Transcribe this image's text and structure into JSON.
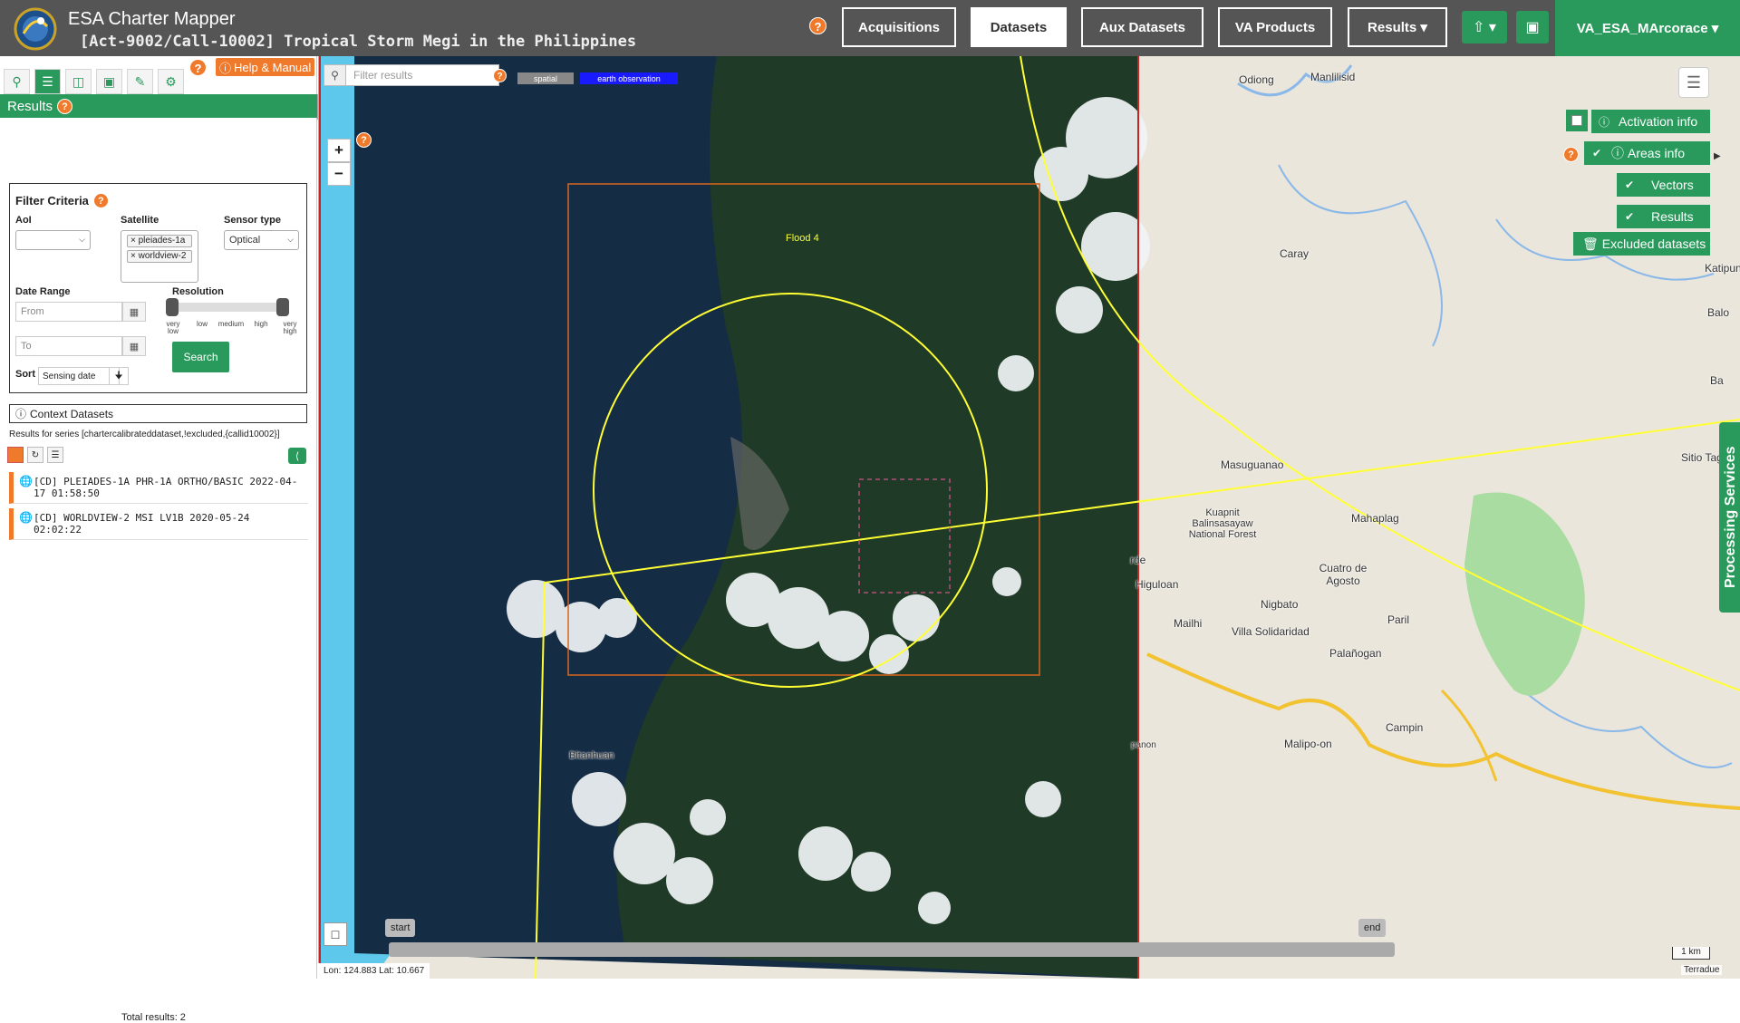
{
  "header": {
    "app_title": "ESA Charter Mapper",
    "activation_title": "[Act-9002/Call-10002] Tropical Storm Megi in the Philippines",
    "help": "?",
    "nav": [
      "Acquisitions",
      "Datasets",
      "Aux Datasets",
      "VA Products",
      "Results ▾"
    ],
    "active_nav": "Datasets",
    "upload_icon": "⇧ ▾",
    "briefcase_icon": "▣",
    "user": "VA_ESA_MArcorace ▾"
  },
  "left_panel": {
    "help_manual": "Help & Manual",
    "results_title": "Results",
    "filter": {
      "title": "Filter Criteria",
      "aoi_label": "AoI",
      "satellite_label": "Satellite",
      "satellite_tags": [
        "× pleiades-1a",
        "× worldview-2"
      ],
      "sensor_label": "Sensor type",
      "sensor_value": "Optical",
      "date_label": "Date Range",
      "from_placeholder": "From",
      "to_placeholder": "To",
      "resolution_label": "Resolution",
      "resolution_ticks": [
        "very low",
        "low",
        "medium",
        "high",
        "very high"
      ],
      "search_label": "Search",
      "sort_label": "Sort",
      "sort_value": "Sensing date"
    },
    "context_title": "Context Datasets",
    "series_line": "Results for series [chartercalibrateddataset,!excluded,{callid10002}]",
    "results": [
      "[CD] PLEIADES-1A PHR-1A ORTHO/BASIC 2022-04-17 01:58:50",
      "[CD] WORLDVIEW-2 MSI LV1B 2020-05-24 02:02:22"
    ],
    "total": "Total results: 2"
  },
  "map": {
    "filter_placeholder": "Filter results",
    "tags": [
      "spatial",
      "earth observation"
    ],
    "zoom_in": "+",
    "zoom_out": "−",
    "flood_label": "Flood 4",
    "overlay_buttons": [
      "Activation info",
      "Areas info",
      "Vectors",
      "Results",
      "Excluded datasets"
    ],
    "processing_services": "Processing Services",
    "timeline_start": "start",
    "timeline_end": "end",
    "coords": "Lon: 124.883 Lat: 10.667",
    "scale": "1 km",
    "attribution": "Terradue",
    "places": [
      "Odiong",
      "Manlilisid",
      "Caray",
      "Katipuna",
      "Balo",
      "Ba",
      "Sitio Tag-ab",
      "Masuguanao",
      "Kuapnit Balinsasayaw National Forest",
      "Mahaplag",
      "Cuatro de Agosto",
      "Nigbato",
      "Higuloan",
      "Mailhi",
      "Villa Solidaridad",
      "Paril",
      "Palañogan",
      "Campin",
      "Malipo-on",
      "Bitanhuan",
      "rde",
      "panon"
    ]
  },
  "colors": {
    "accent_green": "#2a9a5c",
    "help_orange": "#f07a2c",
    "topbar_gray": "#555555",
    "aoi_yellow": "#ffff33",
    "footprint_orange": "#d9661f"
  }
}
